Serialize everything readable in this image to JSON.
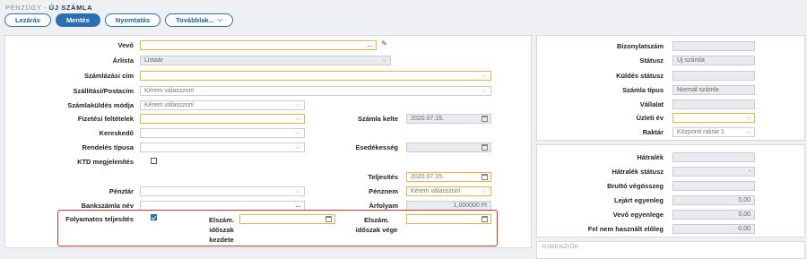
{
  "breadcrumb": {
    "section": "PÉNZÜGY",
    "separator": " - ",
    "page": "ÚJ SZÁMLA"
  },
  "toolbar": {
    "cancel": "Lezárás",
    "save": "Mentés",
    "print": "Nyomtatás",
    "more": "Továbblak..."
  },
  "form": {
    "buyer_label": "Vevő",
    "pricelist_label": "Árlista",
    "pricelist_value": "Listaár",
    "billing_addr_label": "Számlázási cím",
    "shipping_label": "Szállítási/Postacím",
    "shipping_value": "Kérem válasszon!",
    "send_mode_label": "Számlaküldés módja",
    "send_mode_value": "Kérem válasszon!",
    "payment_label": "Fizetési feltételek",
    "invoice_date_label": "Számla kelte",
    "invoice_date_value": "2020.07.15.",
    "dealer_label": "Kereskedő",
    "order_type_label": "Rendelés típusa",
    "due_label": "Esedékesség",
    "ktd_label": "KTD megjelenítés",
    "fulfillment_label": "Teljesítés",
    "fulfillment_value": "2020.07.15.",
    "cashbox_label": "Pénztár",
    "currency_label": "Pénznem",
    "currency_value": "Kérem válasszon!",
    "bank_label": "Bankszámla név",
    "rate_label": "Árfolyam",
    "rate_value": "1,000000 Ft",
    "continuous_label": "Folyamatos teljesítés",
    "period_start_label_1": "Elszám.",
    "period_start_label_2": "időszak",
    "period_start_label_3": "kezdete",
    "period_end_label_1": "Elszám.",
    "period_end_label_2": "időszak vége",
    "more_icon": "..."
  },
  "side": {
    "doc_no_label": "Bizonylatszám",
    "status_label": "Státusz",
    "status_value": "Új számla",
    "send_status_label": "Küldés státusz",
    "invoice_type_label": "Számla típus",
    "invoice_type_value": "Normál számla",
    "company_label": "Vállalat",
    "fiscal_year_label": "Üzleti év",
    "warehouse_label": "Raktár",
    "warehouse_value": "Központi raktár 1"
  },
  "balance": {
    "due_label": "Hátralék",
    "due_status_label": "Hátralék státusz",
    "due_status_value": "-",
    "gross_label": "Bruttó végösszeg",
    "expired_label": "Lejárt egyenleg",
    "expired_value": "0,00",
    "buyer_balance_label": "Vevő egyenlege",
    "buyer_balance_value": "0,00",
    "unused_label": "Fel nem használt előleg",
    "unused_value": "0,00"
  },
  "dimension_title": "DIMENZIÓK",
  "colors": {
    "accent": "#2a6fb0",
    "required": "#f0b23a",
    "highlight": "#d9342b"
  }
}
